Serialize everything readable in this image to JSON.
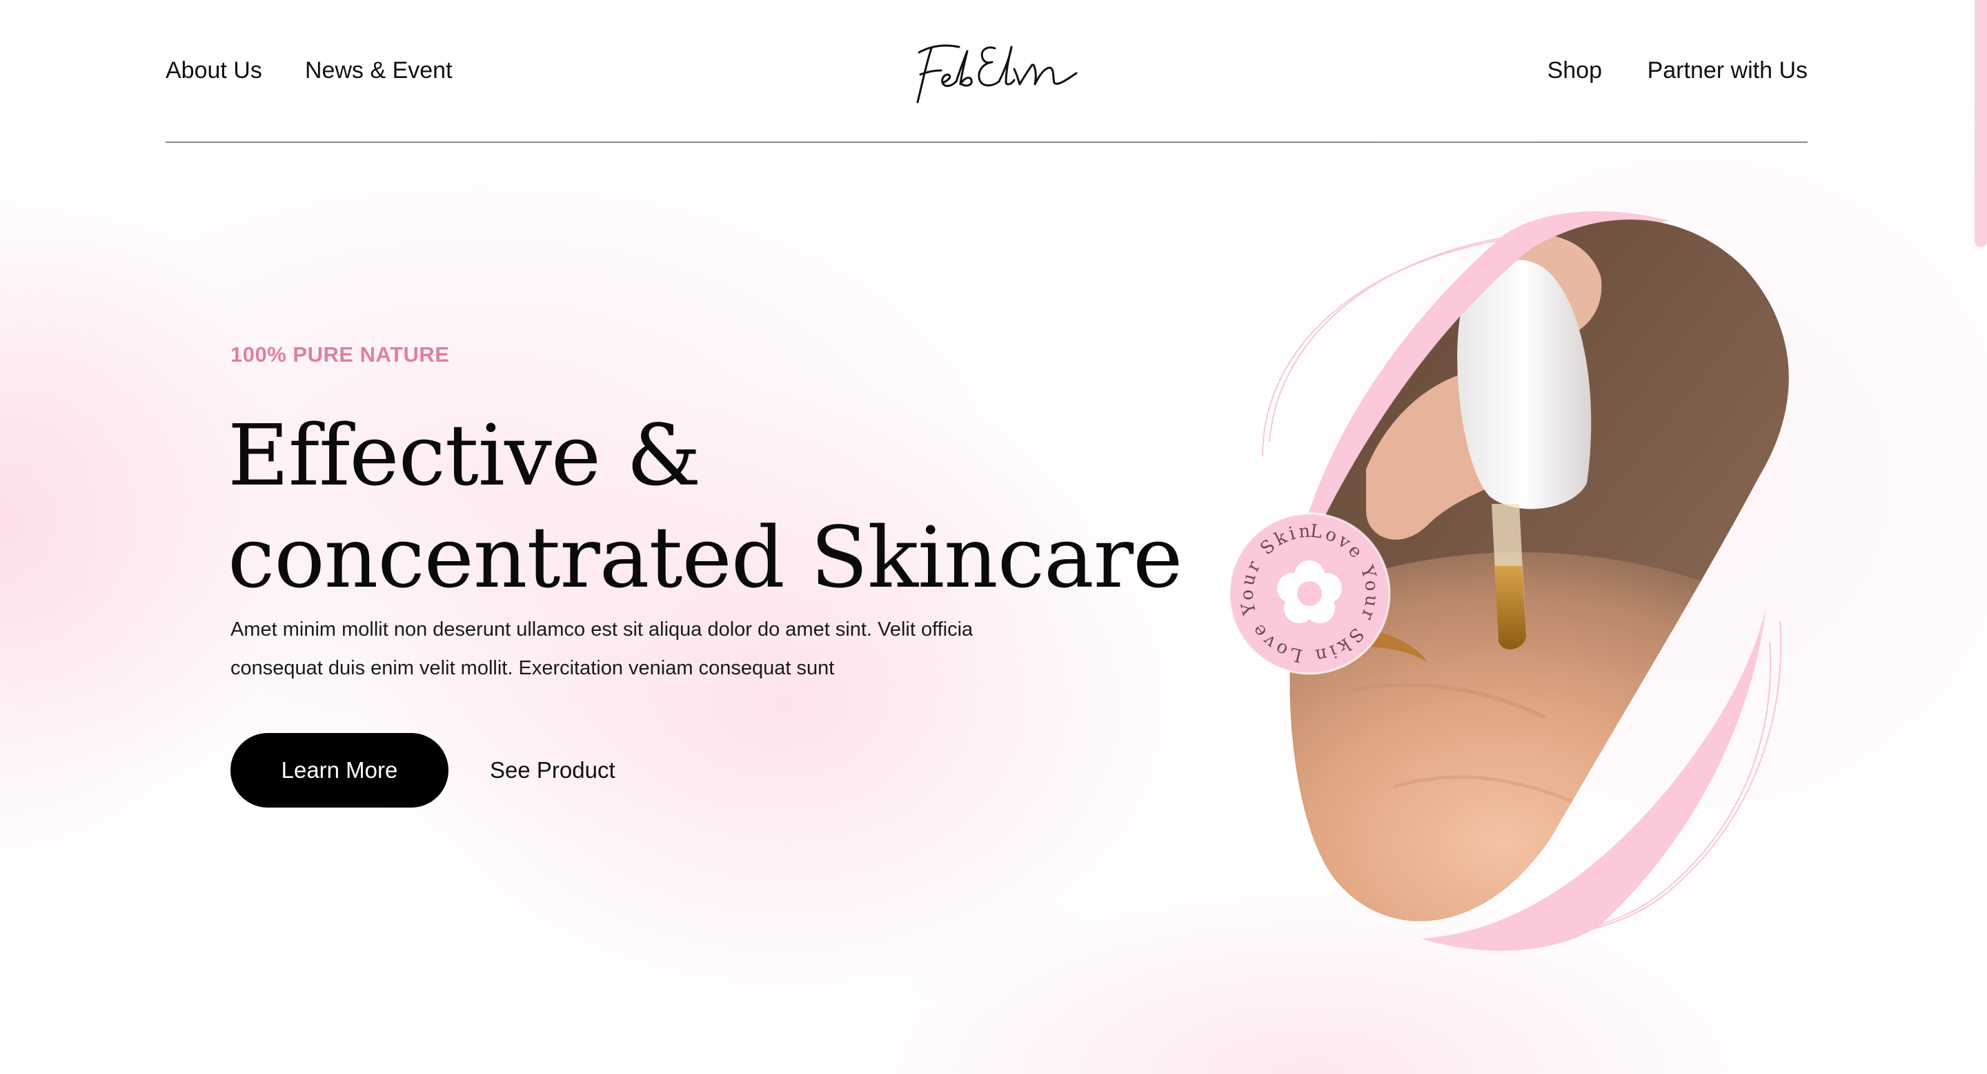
{
  "nav": {
    "about": "About Us",
    "news": "News & Event",
    "shop": "Shop",
    "partner": "Partner with Us"
  },
  "brand": {
    "name": "FebElvn",
    "accent": "#e07f9b",
    "blob_pink": "#fbc8dc"
  },
  "hero": {
    "eyebrow": "100% PURE NATURE",
    "title_line1": "Effective &",
    "title_line2": "concentrated Skincare",
    "description": "Amet minim mollit non deserunt ullamco est sit aliqua dolor do amet sint. Velit officia consequat duis enim velit mollit. Exercitation veniam consequat sunt",
    "learn_more": "Learn More",
    "see_product": "See Product",
    "image_alt": "Serum dropper over hand",
    "badge_text": "Love Your Skin Love Your Skin "
  }
}
